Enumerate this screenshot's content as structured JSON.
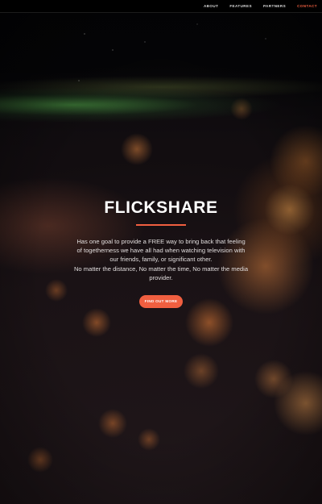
{
  "nav": {
    "items": [
      {
        "label": "ABOUT"
      },
      {
        "label": "FEATURES"
      },
      {
        "label": "PARTNERS"
      },
      {
        "label": "CONTACT"
      }
    ],
    "active_index": 3
  },
  "hero": {
    "title": "FLICKSHARE",
    "description_1": "Has one goal to provide a FREE way to bring back that feeling of togetherness we have all had when watching television with our friends, family, or significant other.",
    "description_2": "No matter the distance, No matter the time, No matter the media provider.",
    "cta_label": "FIND OUT MORE"
  },
  "colors": {
    "accent": "#f05f40",
    "nav_background": "#000000",
    "title_text": "#ffffff"
  }
}
